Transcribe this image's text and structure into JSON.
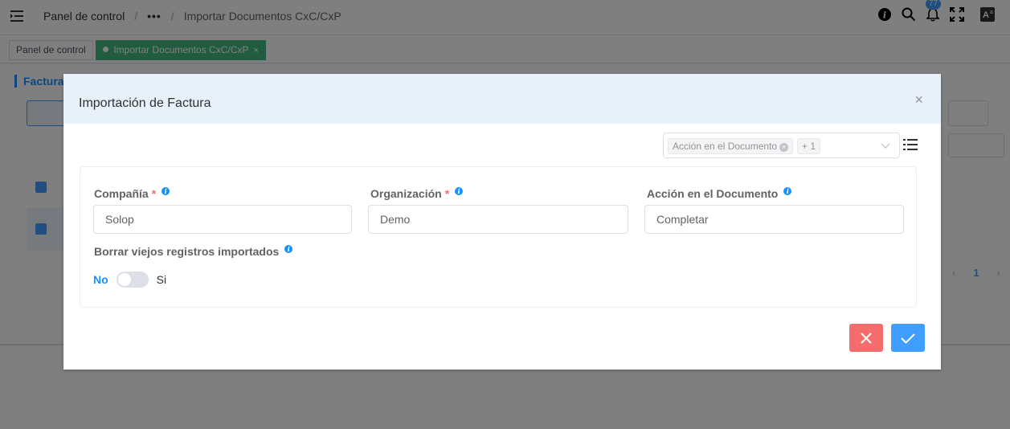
{
  "header": {
    "breadcrumb": [
      "Panel de control",
      "•••",
      "Importar Documentos CxC/CxP"
    ],
    "notification_count": "77",
    "icons": [
      "info-icon",
      "search-icon",
      "bell-icon",
      "fullscreen-icon",
      "translate-icon"
    ]
  },
  "tags": [
    {
      "label": "Panel de control"
    },
    {
      "label": "Importar Documentos CxC/CxP",
      "close": "×"
    }
  ],
  "background": {
    "panel_title": "Factura",
    "pager_current": "1"
  },
  "dialog": {
    "title": "Importación de Factura",
    "close": "×",
    "field_selector": {
      "chip": "Acción en el Documento",
      "more": "+ 1"
    },
    "fields": {
      "company": {
        "label": "Compañía",
        "required": "*",
        "value": "Solop"
      },
      "organization": {
        "label": "Organización",
        "required": "*",
        "value": "Demo"
      },
      "doc_action": {
        "label": "Acción en el Documento",
        "value": "Completar"
      },
      "delete_old": {
        "label": "Borrar viejos registros importados",
        "off_label": "No",
        "on_label": "Si"
      }
    }
  },
  "colors": {
    "accent": "#409eff",
    "danger": "#f56c6c",
    "tag_active": "#42b983"
  }
}
